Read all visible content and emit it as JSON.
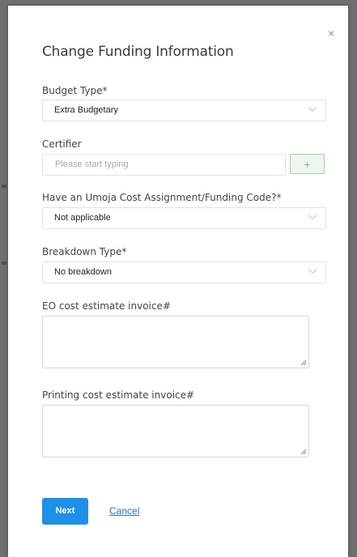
{
  "dialog": {
    "title": "Change Funding Information",
    "close_glyph": "×"
  },
  "budget_type": {
    "label": "Budget Type*",
    "value": "Extra Budgetary"
  },
  "certifier": {
    "label": "Certifier",
    "placeholder": "Please start typing",
    "add_glyph": "+"
  },
  "umoja": {
    "label": "Have an Umoja Cost Assignment/Funding Code?*",
    "value": "Not applicable"
  },
  "breakdown": {
    "label": "Breakdown Type*",
    "value": "No breakdown"
  },
  "eo_invoice": {
    "label": "EO cost estimate invoice#",
    "value": ""
  },
  "printing_invoice": {
    "label": "Printing cost estimate invoice#",
    "value": ""
  },
  "actions": {
    "next_label": "Next",
    "cancel_label": "Cancel"
  },
  "icons": {
    "close": "close-icon",
    "chevron": "chevron-down-icon",
    "add": "plus-icon",
    "resize": "resize-grip-icon"
  },
  "colors": {
    "primary": "#1f8fea",
    "link": "#1f73d6",
    "add_border": "#a9cfa9",
    "overlay": "#6f6f6f"
  }
}
